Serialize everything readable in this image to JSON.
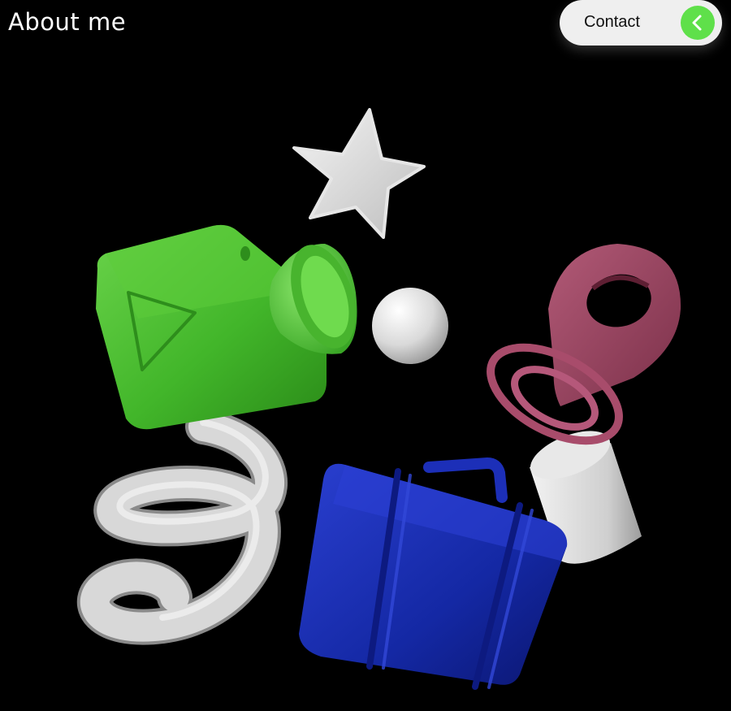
{
  "header": {
    "title": "About me"
  },
  "contact_button": {
    "label": "Contact",
    "icon": "chevron-left-icon",
    "accent_color": "#5fe04a"
  },
  "illustration": {
    "objects": [
      "star",
      "video-camera",
      "sphere",
      "location-pin",
      "rings",
      "spring-coil",
      "briefcase",
      "cylinder"
    ],
    "colors": {
      "camera": "#44c22c",
      "briefcase": "#1626a6",
      "pin": "#9b4662",
      "neutral": "#d7d7d7"
    }
  }
}
